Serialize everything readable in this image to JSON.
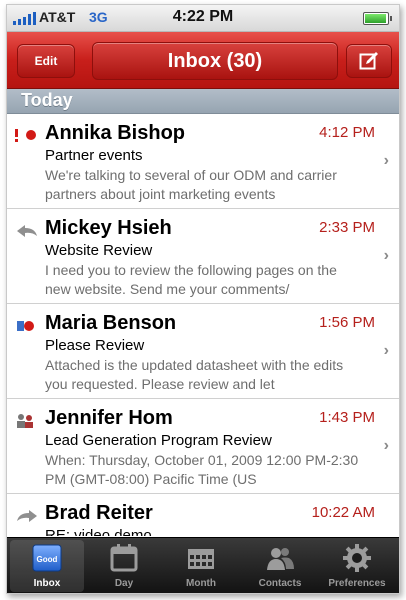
{
  "status_bar": {
    "carrier": "AT&T",
    "network": "3G",
    "time": "4:22 PM"
  },
  "nav": {
    "edit_label": "Edit",
    "title": "Inbox (30)"
  },
  "section": {
    "label": "Today"
  },
  "messages": [
    {
      "sender": "Annika Bishop",
      "time": "4:12 PM",
      "subject": "Partner events",
      "preview": "We're talking to several of our ODM and carrier partners about joint marketing events",
      "icon": "urgent-unread-icon"
    },
    {
      "sender": "Mickey Hsieh",
      "time": "2:33 PM",
      "subject": "Website Review",
      "preview": "I need you to review the following pages on the new website.  Send me your comments/",
      "icon": "reply-icon"
    },
    {
      "sender": "Maria Benson",
      "time": "1:56 PM",
      "subject": "Please Review",
      "preview": "Attached is the updated datasheet with the edits you requested.  Please review and let",
      "icon": "attachment-unread-icon"
    },
    {
      "sender": "Jennifer Hom",
      "time": "1:43 PM",
      "subject": "Lead Generation Program Review",
      "preview": "When: Thursday, October 01, 2009 12:00 PM-2:30 PM (GMT-08:00) Pacific Time (US",
      "icon": "meeting-icon"
    },
    {
      "sender": "Brad Reiter",
      "time": "10:22 AM",
      "subject": "RE: video demo",
      "preview": "",
      "icon": "forward-icon"
    }
  ],
  "tabs": [
    {
      "label": "Inbox",
      "icon": "inbox-icon",
      "icon_text": "Good"
    },
    {
      "label": "Day",
      "icon": "day-calendar-icon"
    },
    {
      "label": "Month",
      "icon": "month-calendar-icon"
    },
    {
      "label": "Contacts",
      "icon": "contacts-icon"
    },
    {
      "label": "Preferences",
      "icon": "gear-icon"
    }
  ],
  "colors": {
    "nav_red": "#c81f1b",
    "time_red": "#b5201c",
    "section_gray": "#a3b0bc",
    "tab_bar": "#1e1e1e"
  }
}
